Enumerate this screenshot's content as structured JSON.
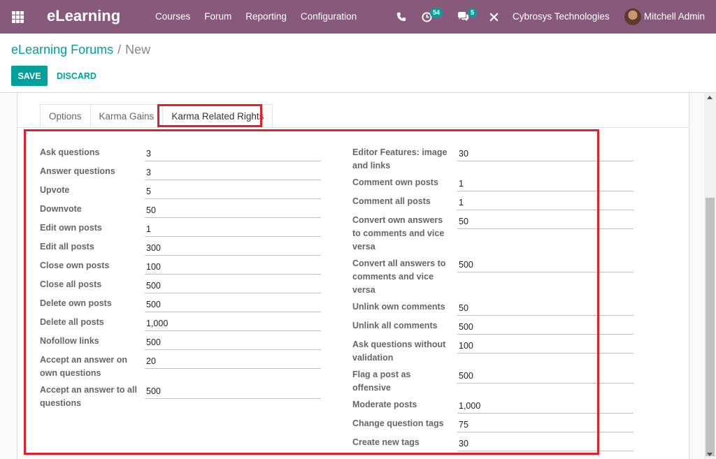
{
  "app": {
    "brand": "eLearning",
    "menu": [
      "Courses",
      "Forum",
      "Reporting",
      "Configuration"
    ],
    "activity_count": "54",
    "message_count": "5",
    "company": "Cybrosys Technologies",
    "user": "Mitchell Admin"
  },
  "breadcrumb": {
    "parent": "eLearning Forums",
    "separator": "/",
    "current": "New"
  },
  "buttons": {
    "save": "SAVE",
    "discard": "DISCARD"
  },
  "tabs": [
    "Options",
    "Karma Gains",
    "Karma Related Rights"
  ],
  "active_tab": "Karma Related Rights",
  "left_fields": [
    {
      "label": "Ask questions",
      "value": "3"
    },
    {
      "label": "Answer questions",
      "value": "3"
    },
    {
      "label": "Upvote",
      "value": "5"
    },
    {
      "label": "Downvote",
      "value": "50"
    },
    {
      "label": "Edit own posts",
      "value": "1"
    },
    {
      "label": "Edit all posts",
      "value": "300"
    },
    {
      "label": "Close own posts",
      "value": "100"
    },
    {
      "label": "Close all posts",
      "value": "500"
    },
    {
      "label": "Delete own posts",
      "value": "500"
    },
    {
      "label": "Delete all posts",
      "value": "1,000"
    },
    {
      "label": "Nofollow links",
      "value": "500"
    },
    {
      "label": "Accept an answer on own questions",
      "value": "20"
    },
    {
      "label": "Accept an answer to all questions",
      "value": "500"
    }
  ],
  "right_fields": [
    {
      "label": "Editor Features: image and links",
      "value": "30"
    },
    {
      "label": "Comment own posts",
      "value": "1"
    },
    {
      "label": "Comment all posts",
      "value": "1"
    },
    {
      "label": "Convert own answers to comments and vice versa",
      "value": "50"
    },
    {
      "label": "Convert all answers to comments and vice versa",
      "value": "500"
    },
    {
      "label": "Unlink own comments",
      "value": "50"
    },
    {
      "label": "Unlink all comments",
      "value": "500"
    },
    {
      "label": "Ask questions without validation",
      "value": "100"
    },
    {
      "label": "Flag a post as offensive",
      "value": "500"
    },
    {
      "label": "Moderate posts",
      "value": "1,000"
    },
    {
      "label": "Change question tags",
      "value": "75"
    },
    {
      "label": "Create new tags",
      "value": "30"
    }
  ],
  "colors": {
    "navbar": "#875a7b",
    "primary": "#00a09d",
    "highlight": "#e0202a"
  }
}
